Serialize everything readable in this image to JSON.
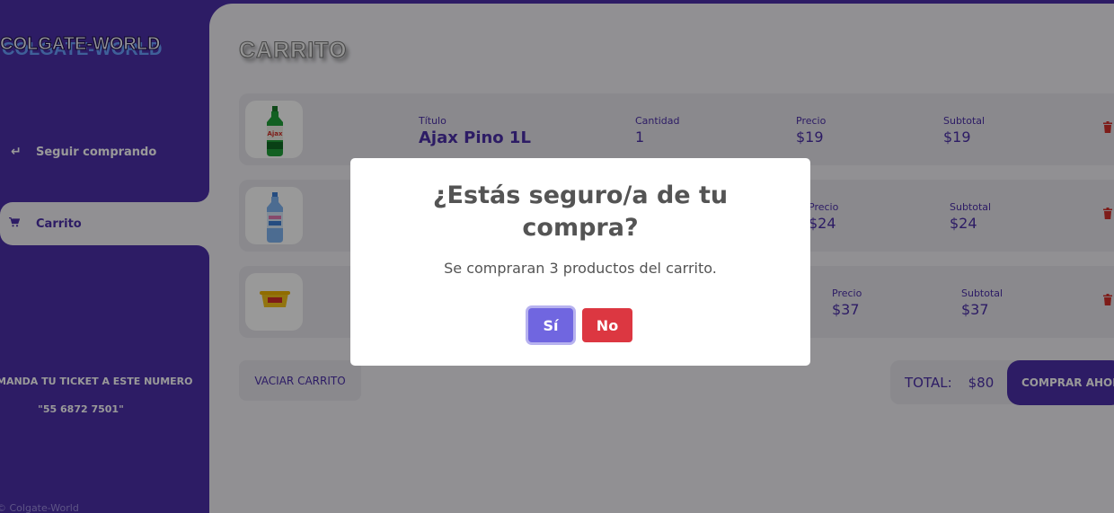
{
  "sidebar": {
    "logo": "COLGATE-WORLD",
    "nav_continue": "Seguir comprando",
    "nav_cart": "Carrito",
    "ticket_text": "MANDA TU TICKET A ESTE NUMERO",
    "ticket_number": "\"55 6872 7501\"",
    "copyright": "© Colgate-World"
  },
  "main": {
    "title": "CARRITO",
    "labels": {
      "title": "Título",
      "quantity": "Cantidad",
      "price": "Precio",
      "subtotal": "Subtotal"
    },
    "items": [
      {
        "title": "Ajax Pino 1L",
        "quantity": "1",
        "price": "$19",
        "subtotal": "$19"
      },
      {
        "price": "$24",
        "subtotal": "$24"
      },
      {
        "price": "$37",
        "subtotal": "$37"
      }
    ],
    "empty_button": "VACIAR CARRITO",
    "total_label": "TOTAL:",
    "total_value": "$80",
    "buy_button": "COMPRAR AHORA"
  },
  "modal": {
    "title": "¿Estás seguro/a de tu compra?",
    "text": "Se compraran 3 productos del carrito.",
    "confirm": "Sí",
    "cancel": "No"
  },
  "colors": {
    "brand": "#4b2fa8",
    "background": "#f2f1f6",
    "confirm": "#7066e0",
    "cancel": "#dc3741",
    "trash": "#d3302a"
  },
  "icons": {
    "continue": "return-arrow-icon",
    "cart": "cart-icon",
    "delete": "trash-icon"
  }
}
